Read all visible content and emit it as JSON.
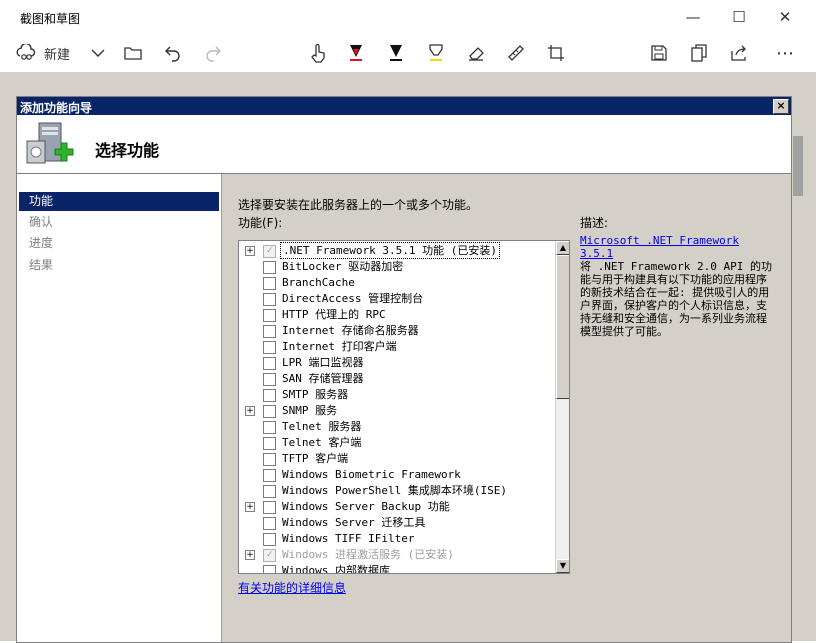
{
  "app": {
    "title": "截图和草图",
    "new_label": "新建"
  },
  "window_controls": {
    "minimize": "—",
    "maximize": "☐",
    "close": "✕"
  },
  "wizard": {
    "title": "添加功能向导",
    "header": "选择功能",
    "close_glyph": "×",
    "nav": [
      {
        "label": "功能",
        "active": true
      },
      {
        "label": "确认",
        "active": false
      },
      {
        "label": "进度",
        "active": false
      },
      {
        "label": "结果",
        "active": false
      }
    ],
    "intro": "选择要安装在此服务器上的一个或多个功能。",
    "features_label": "功能(F):",
    "description_label": "描述:",
    "features": [
      {
        "label": ".NET Framework 3.5.1 功能  (已安装)",
        "expandable": true,
        "checked": true,
        "disabled": true,
        "selected": true
      },
      {
        "label": "BitLocker 驱动器加密",
        "expandable": false,
        "checked": false
      },
      {
        "label": "BranchCache",
        "expandable": false,
        "checked": false
      },
      {
        "label": "DirectAccess 管理控制台",
        "expandable": false,
        "checked": false
      },
      {
        "label": "HTTP 代理上的 RPC",
        "expandable": false,
        "checked": false
      },
      {
        "label": "Internet 存储命名服务器",
        "expandable": false,
        "checked": false
      },
      {
        "label": "Internet 打印客户端",
        "expandable": false,
        "checked": false
      },
      {
        "label": "LPR 端口监视器",
        "expandable": false,
        "checked": false
      },
      {
        "label": "SAN 存储管理器",
        "expandable": false,
        "checked": false
      },
      {
        "label": "SMTP 服务器",
        "expandable": false,
        "checked": false
      },
      {
        "label": "SNMP 服务",
        "expandable": true,
        "checked": false
      },
      {
        "label": "Telnet 服务器",
        "expandable": false,
        "checked": false
      },
      {
        "label": "Telnet 客户端",
        "expandable": false,
        "checked": false
      },
      {
        "label": "TFTP 客户端",
        "expandable": false,
        "checked": false
      },
      {
        "label": "Windows Biometric Framework",
        "expandable": false,
        "checked": false
      },
      {
        "label": "Windows PowerShell 集成脚本环境(ISE)",
        "expandable": false,
        "checked": false
      },
      {
        "label": "Windows Server Backup 功能",
        "expandable": true,
        "checked": false
      },
      {
        "label": "Windows Server 迁移工具",
        "expandable": false,
        "checked": false
      },
      {
        "label": "Windows TIFF IFilter",
        "expandable": false,
        "checked": false
      },
      {
        "label": "Windows 进程激活服务  (已安装)",
        "expandable": true,
        "checked": true,
        "disabled": true
      },
      {
        "label": "Windows 内部数据库",
        "expandable": false,
        "checked": false
      }
    ],
    "description_link": "Microsoft .NET Framework 3.5.1",
    "description_text": "将 .NET Framework 2.0 API 的功能与用于构建具有以下功能的应用程序的新技术结合在一起: 提供吸引人的用户界面，保护客户的个人标识信息，支持无缝和安全通信，为一系列业务流程模型提供了可能。",
    "more_info_link": "有关功能的详细信息"
  }
}
